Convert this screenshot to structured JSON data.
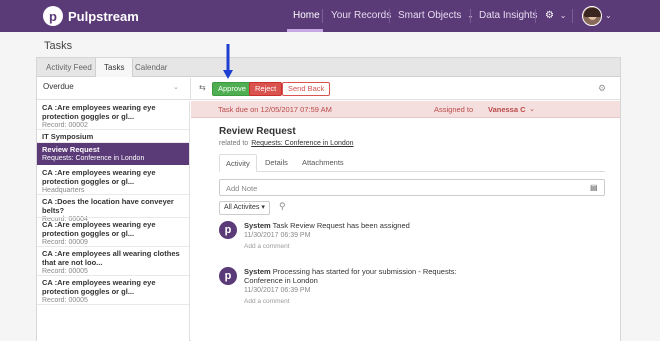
{
  "brand": {
    "name": "Pulpstream",
    "logo_letter": "p"
  },
  "nav": {
    "items": [
      {
        "label": "Home"
      },
      {
        "label": "Your Records"
      },
      {
        "label": "Smart Objects"
      },
      {
        "label": "Data Insights"
      }
    ],
    "caret": "⌄",
    "gear": "⚙"
  },
  "page": {
    "title": "Tasks"
  },
  "tabs": [
    {
      "label": "Activity Feed"
    },
    {
      "label": "Tasks"
    },
    {
      "label": "Calendar"
    }
  ],
  "toolbar": {
    "filter": "Overdue",
    "filter_caret": "⌄",
    "flash_icon": "⇆",
    "approve": "Approve",
    "reject": "Reject",
    "send_back": "Send Back",
    "gear": "⚙"
  },
  "list": [
    {
      "title": "CA :Are employees wearing eye protection goggles or gl...",
      "sub": "Record: 00002"
    },
    {
      "title": "IT Symposium",
      "sub": ""
    },
    {
      "title": "Review Request",
      "sub": "Requests: Conference in London"
    },
    {
      "title": "CA :Are employees wearing eye protection goggles or gl...",
      "sub": "Headquarters"
    },
    {
      "title": "CA :Does the location have conveyer belts?",
      "sub": "Record: 00004"
    },
    {
      "title": "CA :Are employees wearing eye protection goggles or gl...",
      "sub": "Record: 00009"
    },
    {
      "title": "CA :Are employees all wearing clothes that are not loo...",
      "sub": "Record: 00005"
    },
    {
      "title": "CA :Are employees wearing eye protection goggles or gl...",
      "sub": "Record: 00005"
    }
  ],
  "detail": {
    "due": "Task due on 12/05/2017 07:59 AM",
    "assigned_label": "Assigned to",
    "assigned_name": "Vanessa C",
    "assigned_caret": "⌄",
    "title": "Review Request",
    "related_label": "related to",
    "related_link": "Requests: Conference in London",
    "tabs": [
      {
        "label": "Activity"
      },
      {
        "label": "Details"
      },
      {
        "label": "Attachments"
      }
    ],
    "add_note_placeholder": "Add Note",
    "all_activities": "All Activites ▾",
    "activities": [
      {
        "user": "System",
        "text": "Task Review Request has been assigned",
        "text2": "",
        "time": "11/30/2017 06:39 PM",
        "comment": "Add a comment"
      },
      {
        "user": "System",
        "text": "Processing has started for your submission - Requests:",
        "text2": "Conference in London",
        "time": "11/30/2017 06:39 PM",
        "comment": "Add a comment"
      }
    ]
  },
  "colors": {
    "nav": "#5b3a78",
    "approve": "#4fae51",
    "reject": "#d9534f",
    "arrow": "#1f3fd1"
  }
}
